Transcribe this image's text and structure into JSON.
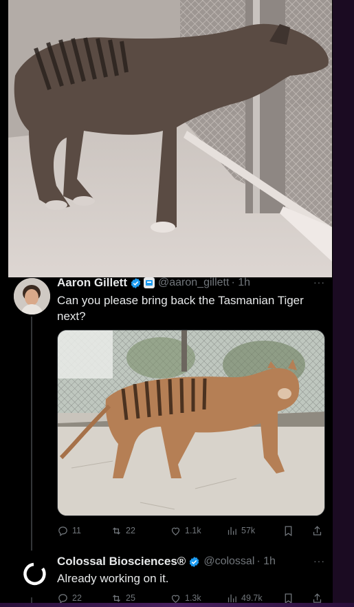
{
  "tweet1": {
    "author_name": "Aaron Gillett",
    "handle": "@aaron_gillett",
    "time": "· 1h",
    "more": "···",
    "text": "Can you please bring back the Tasmanian Tiger next?",
    "stats": {
      "replies": "11",
      "reposts": "22",
      "likes": "1.1k",
      "views": "57k"
    }
  },
  "tweet2": {
    "author_name": "Colossal Biosciences®",
    "handle": "@colossal",
    "time": "· 1h",
    "more": "···",
    "text": "Already working on it.",
    "stats": {
      "replies": "22",
      "reposts": "25",
      "likes": "1.3k",
      "views": "49.7k"
    }
  },
  "colors": {
    "background": "#000000",
    "text": "#e7e9ea",
    "muted": "#71767b",
    "verified": "#1d9bf0"
  }
}
